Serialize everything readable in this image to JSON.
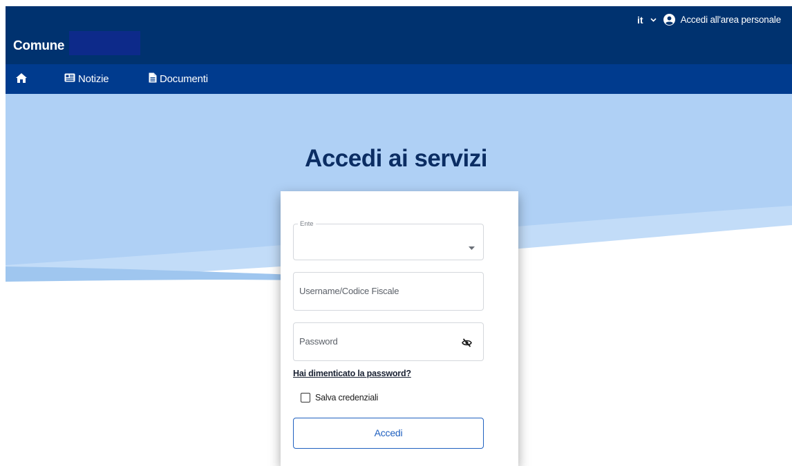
{
  "header": {
    "brand": "Comune",
    "language": "it",
    "login_link": "Accedi all'area personale"
  },
  "nav": {
    "items": [
      {
        "label": "",
        "icon": "home-icon"
      },
      {
        "label": "Notizie",
        "icon": "newspaper-icon"
      },
      {
        "label": "Documenti",
        "icon": "document-icon"
      }
    ]
  },
  "page": {
    "title": "Accedi ai servizi"
  },
  "form": {
    "ente_label": "Ente",
    "ente_value": "",
    "username_placeholder": "Username/Codice Fiscale",
    "password_placeholder": "Password",
    "forgot_password": "Hai dimenticato la password?",
    "remember_label": "Salva credenziali",
    "remember_checked": false,
    "submit_label": "Accedi"
  },
  "colors": {
    "header_bg": "#00326f",
    "nav_bg": "#003b8e",
    "hero_light_blue": "#b3d3f7",
    "title": "#0b2d63",
    "accent": "#1e5fbf"
  }
}
